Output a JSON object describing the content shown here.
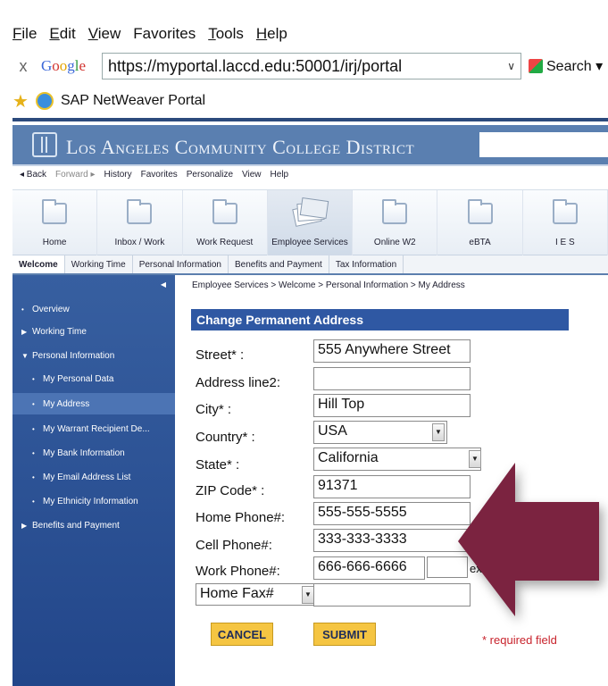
{
  "browser": {
    "menu": [
      {
        "key": "F",
        "rest": "ile"
      },
      {
        "key": "E",
        "rest": "dit"
      },
      {
        "key": "V",
        "rest": "iew"
      },
      {
        "key": "",
        "rest": "Favorites"
      },
      {
        "key": "T",
        "rest": "ools"
      },
      {
        "key": "H",
        "rest": "elp"
      }
    ],
    "close_glyph": "x",
    "google_label": "Google",
    "url": "https://myportal.laccd.edu:50001/irj/portal",
    "search_label": "Search ▾",
    "favorites_title": "SAP NetWeaver Portal"
  },
  "portal": {
    "district_title": "Los Angeles Community College District",
    "nav": {
      "back": "◂ Back",
      "forward": "Forward ▸",
      "history": "History",
      "favorites": "Favorites",
      "personalize": "Personalize",
      "view": "View",
      "help": "Help"
    },
    "big_tabs": [
      {
        "label": "Home"
      },
      {
        "label": "Inbox / Work"
      },
      {
        "label": "Work Request"
      },
      {
        "label": "Employee Services",
        "active": true
      },
      {
        "label": "Online W2"
      },
      {
        "label": "eBTA"
      },
      {
        "label": "I E S"
      }
    ],
    "sub_tabs": [
      {
        "label": "Welcome",
        "active": true
      },
      {
        "label": "Working Time"
      },
      {
        "label": "Personal Information"
      },
      {
        "label": "Benefits and Payment"
      },
      {
        "label": "Tax Information"
      }
    ],
    "sidebar": {
      "collapse_glyph": "◀",
      "items": [
        {
          "label": "Overview",
          "marker": "•"
        },
        {
          "label": "Working Time",
          "marker": "▶"
        },
        {
          "label": "Personal Information",
          "marker": "▼"
        },
        {
          "label": "My Personal Data",
          "marker": "•"
        },
        {
          "label": "My Address",
          "marker": "•",
          "selected": true
        },
        {
          "label": "My Warrant Recipient De...",
          "marker": "•"
        },
        {
          "label": "My Bank Information",
          "marker": "•"
        },
        {
          "label": "My Email Address List",
          "marker": "•"
        },
        {
          "label": "My Ethnicity Information",
          "marker": "•"
        },
        {
          "label": "Benefits and Payment",
          "marker": "▶"
        }
      ]
    },
    "breadcrumb": "Employee Services  >  Welcome  >  Personal Information  >  My Address"
  },
  "form": {
    "title": "Change Permanent Address",
    "street_label": "Street* :",
    "street_value": "555 Anywhere Street",
    "address2_label": "Address line2:",
    "address2_value": "",
    "city_label": "City* :",
    "city_value": "Hill Top",
    "country_label": "Country* :",
    "country_value": "USA",
    "state_label": "State* :",
    "state_value": "California",
    "zip_label": "ZIP Code* :",
    "zip_value": "91371",
    "home_phone_label": "Home Phone#:",
    "home_phone_value": "555-555-5555",
    "cell_phone_label": "Cell Phone#:",
    "cell_phone_value": "333-333-3333",
    "work_phone_label": "Work Phone#:",
    "work_phone_value": "666-666-6666",
    "ext_label": "ex.",
    "fax_type_value": "Home Fax#",
    "fax_value": "",
    "cancel_label": "CANCEL",
    "submit_label": "SUBMIT",
    "required_note": "* required field",
    "dropdown_glyph": "▼"
  },
  "colors": {
    "header_blue": "#5a7fb0",
    "sidebar_blue": "#2c528f",
    "title_bar_blue": "#2f58a3",
    "button_yellow": "#f5c542",
    "required_red": "#c8232c",
    "arrow_maroon": "#7b2340"
  }
}
